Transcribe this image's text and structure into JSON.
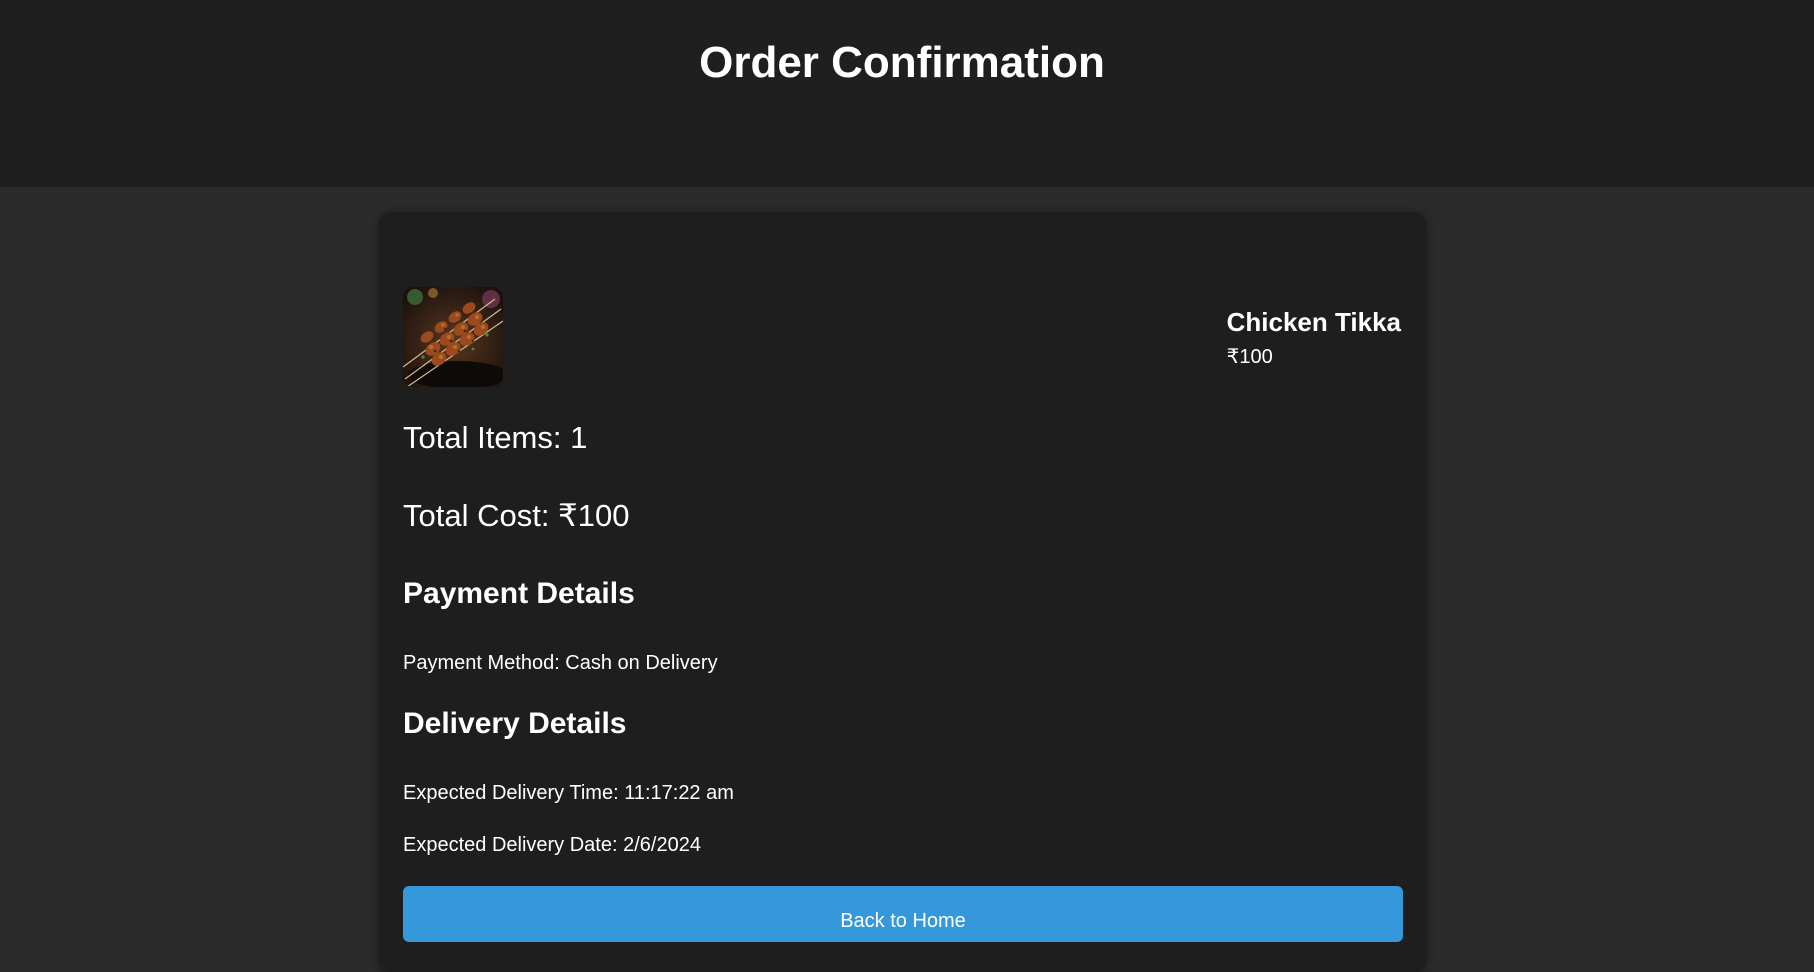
{
  "page": {
    "title": "Order Confirmation"
  },
  "order": {
    "items": [
      {
        "name": "Chicken Tikka",
        "price": "₹100",
        "image": "chicken-tikka-skewers"
      }
    ],
    "total_items_label": "Total Items: 1",
    "total_cost_label": "Total Cost: ₹100"
  },
  "payment": {
    "heading": "Payment Details",
    "method_label": "Payment Method: Cash on Delivery"
  },
  "delivery": {
    "heading": "Delivery Details",
    "time_label": "Expected Delivery Time: 11:17:22 am",
    "date_label": "Expected Delivery Date: 2/6/2024"
  },
  "actions": {
    "back_home_label": "Back to Home"
  },
  "colors": {
    "header_bg": "#1f1f1f",
    "page_bg": "#2b2b2b",
    "card_bg": "#1e1e1e",
    "button_bg": "#3498db",
    "text": "#ffffff"
  }
}
